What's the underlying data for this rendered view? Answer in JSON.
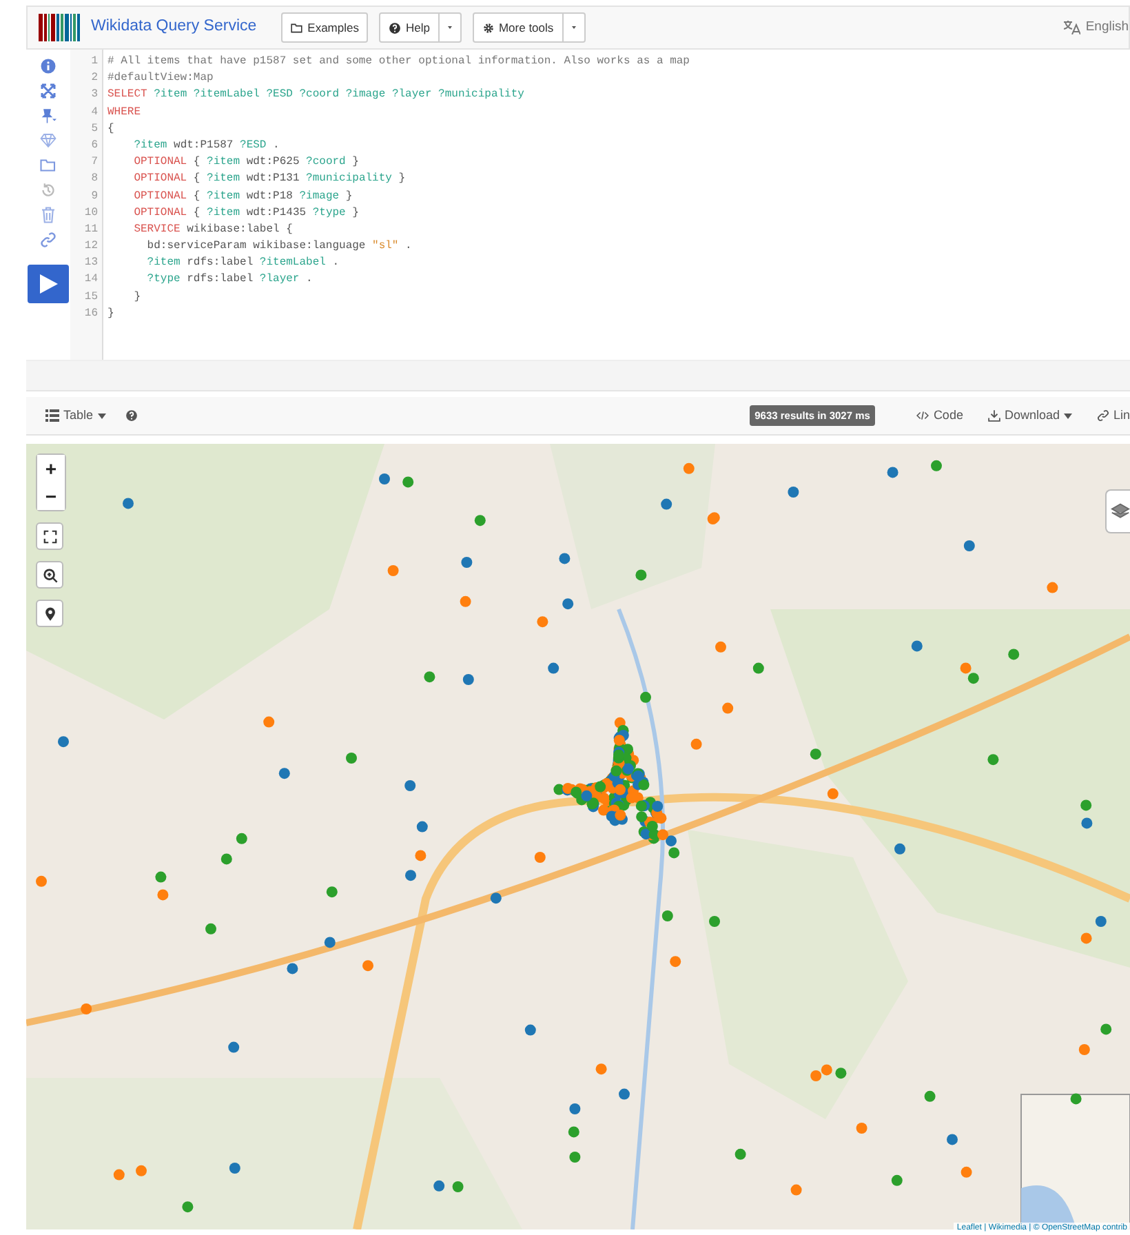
{
  "header": {
    "title": "Wikidata Query Service",
    "buttons": [
      {
        "label": "Examples",
        "dropdown": false
      },
      {
        "label": "Help",
        "dropdown": true
      },
      {
        "label": "More tools",
        "dropdown": true
      }
    ],
    "language": "English"
  },
  "editor": {
    "lines": [
      {
        "number": "1",
        "tokens": [
          {
            "kind": "comment",
            "text": "# All items that have p1587 set and some other optional information. Also works as a map"
          }
        ]
      },
      {
        "number": "2",
        "tokens": [
          {
            "kind": "comment",
            "text": "#defaultView:Map"
          }
        ]
      },
      {
        "number": "3",
        "tokens": [
          {
            "kind": "keyword",
            "text": "SELECT"
          },
          {
            "kind": "var",
            "text": " ?item ?itemLabel ?ESD ?coord ?image ?layer ?municipality"
          }
        ]
      },
      {
        "number": "4",
        "tokens": [
          {
            "kind": "keyword",
            "text": "WHERE"
          }
        ]
      },
      {
        "number": "5",
        "tokens": [
          {
            "kind": "plain",
            "text": "{"
          }
        ]
      },
      {
        "number": "6",
        "tokens": [
          {
            "kind": "var",
            "text": "    ?item"
          },
          {
            "kind": "plain",
            "text": " wdt:P1587 "
          },
          {
            "kind": "var",
            "text": "?ESD"
          },
          {
            "kind": "plain",
            "text": " ."
          }
        ]
      },
      {
        "number": "7",
        "tokens": [
          {
            "kind": "keyword",
            "text": "    OPTIONAL"
          },
          {
            "kind": "plain",
            "text": " { "
          },
          {
            "kind": "var",
            "text": "?item"
          },
          {
            "kind": "plain",
            "text": " wdt:P625 "
          },
          {
            "kind": "var",
            "text": "?coord"
          },
          {
            "kind": "plain",
            "text": " }"
          }
        ]
      },
      {
        "number": "8",
        "tokens": [
          {
            "kind": "keyword",
            "text": "    OPTIONAL"
          },
          {
            "kind": "plain",
            "text": " { "
          },
          {
            "kind": "var",
            "text": "?item"
          },
          {
            "kind": "plain",
            "text": " wdt:P131 "
          },
          {
            "kind": "var",
            "text": "?municipality"
          },
          {
            "kind": "plain",
            "text": " }"
          }
        ]
      },
      {
        "number": "9",
        "tokens": [
          {
            "kind": "keyword",
            "text": "    OPTIONAL"
          },
          {
            "kind": "plain",
            "text": " { "
          },
          {
            "kind": "var",
            "text": "?item"
          },
          {
            "kind": "plain",
            "text": " wdt:P18 "
          },
          {
            "kind": "var",
            "text": "?image"
          },
          {
            "kind": "plain",
            "text": " }"
          }
        ]
      },
      {
        "number": "10",
        "tokens": [
          {
            "kind": "keyword",
            "text": "    OPTIONAL"
          },
          {
            "kind": "plain",
            "text": " { "
          },
          {
            "kind": "var",
            "text": "?item"
          },
          {
            "kind": "plain",
            "text": " wdt:P1435 "
          },
          {
            "kind": "var",
            "text": "?type"
          },
          {
            "kind": "plain",
            "text": " }"
          }
        ]
      },
      {
        "number": "11",
        "tokens": [
          {
            "kind": "keyword",
            "text": "    SERVICE"
          },
          {
            "kind": "plain",
            "text": " wikibase:label {"
          }
        ]
      },
      {
        "number": "12",
        "tokens": [
          {
            "kind": "plain",
            "text": "      bd:serviceParam wikibase:language "
          },
          {
            "kind": "string",
            "text": "\"sl\""
          },
          {
            "kind": "plain",
            "text": " ."
          }
        ]
      },
      {
        "number": "13",
        "tokens": [
          {
            "kind": "var",
            "text": "      ?item"
          },
          {
            "kind": "plain",
            "text": " rdfs:label "
          },
          {
            "kind": "var",
            "text": "?itemLabel"
          },
          {
            "kind": "plain",
            "text": " ."
          }
        ]
      },
      {
        "number": "14",
        "tokens": [
          {
            "kind": "var",
            "text": "      ?type"
          },
          {
            "kind": "plain",
            "text": " rdfs:label "
          },
          {
            "kind": "var",
            "text": "?layer"
          },
          {
            "kind": "plain",
            "text": " ."
          }
        ]
      },
      {
        "number": "15",
        "tokens": [
          {
            "kind": "plain",
            "text": "    }"
          }
        ]
      },
      {
        "number": "16",
        "tokens": [
          {
            "kind": "plain",
            "text": "}"
          }
        ]
      }
    ]
  },
  "results": {
    "view": "Table",
    "summary": "9633 results in 3027 ms",
    "actions": [
      {
        "label": "Code",
        "dropdown": false
      },
      {
        "label": "Download",
        "dropdown": true
      },
      {
        "label": "Lin",
        "dropdown": false
      }
    ]
  },
  "map": {
    "kind": "picture",
    "zoom_in": "+",
    "zoom_out": "−",
    "attribution": "Leaflet | Wikimedia | © OpenStreetMap contrib"
  }
}
